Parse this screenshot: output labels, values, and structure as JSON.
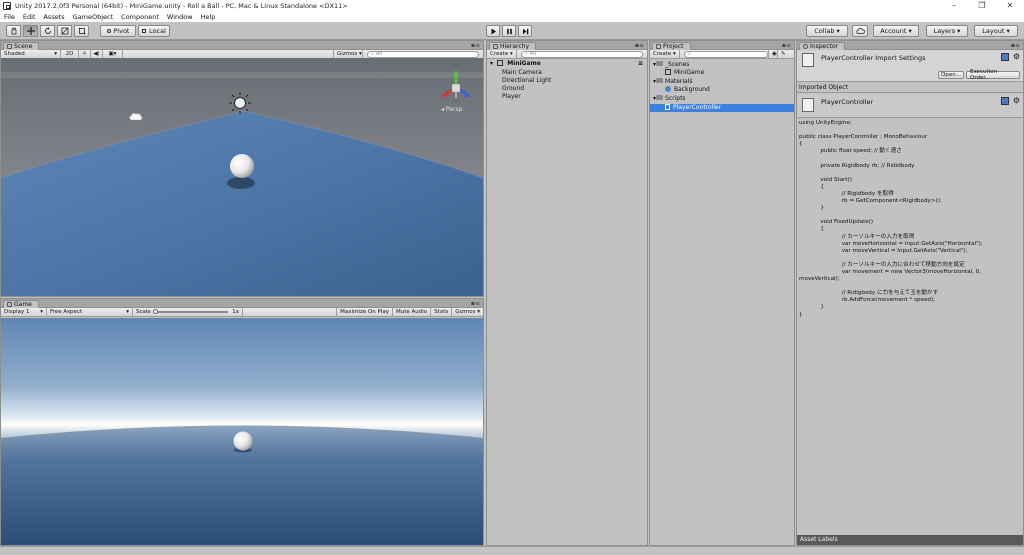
{
  "window": {
    "title": "Unity 2017.2.0f3 Personal (64bit) - MiniGame.unity - Roll a Ball - PC, Mac & Linux Standalone <DX11>",
    "minimize": "–",
    "maximize": "❐",
    "close": "✕"
  },
  "menu": [
    "File",
    "Edit",
    "Assets",
    "GameObject",
    "Component",
    "Window",
    "Help"
  ],
  "toolbar": {
    "pivot": "Pivot",
    "local": "Local",
    "collab": "Collab ▾",
    "account": "Account ▾",
    "layers": "Layers ▾",
    "layout": "Layout ▾"
  },
  "scene": {
    "tab": "Scene",
    "shading": "Shaded",
    "mode_2d": "2D",
    "gizmos": "Gizmos ▾",
    "search": "All",
    "persp": "Persp"
  },
  "game": {
    "tab": "Game",
    "display": "Display 1",
    "aspect": "Free Aspect",
    "scale_label": "Scale",
    "scale_value": "1x",
    "maximize": "Maximize On Play",
    "mute": "Mute Audio",
    "stats": "Stats",
    "gizmos": "Gizmos ▾"
  },
  "hierarchy": {
    "tab": "Hierarchy",
    "create": "Create ▾",
    "search": "All",
    "scene_name": "MiniGame",
    "items": [
      "Main Camera",
      "Directional Light",
      "Ground",
      "Player"
    ]
  },
  "project": {
    "tab": "Project",
    "create": "Create ▾",
    "tree": [
      {
        "label": "_Scenes",
        "kind": "folder",
        "depth": 0
      },
      {
        "label": "MiniGame",
        "kind": "scene",
        "depth": 1
      },
      {
        "label": "Materials",
        "kind": "folder",
        "depth": 0
      },
      {
        "label": "Background",
        "kind": "material",
        "depth": 1
      },
      {
        "label": "Scripts",
        "kind": "folder",
        "depth": 0
      },
      {
        "label": "PlayerController",
        "kind": "script",
        "depth": 1
      }
    ]
  },
  "inspector": {
    "tab": "Inspector",
    "import_title": "PlayerController Import Settings",
    "open_button": "Open...",
    "execution_order_button": "Execution Order...",
    "imported_object": "Imported Object",
    "object_name": "PlayerController",
    "asset_labels": "Asset Labels",
    "code": "using UnityEngine;\n\npublic class PlayerController : MonoBehaviour\n{\n\t\tpublic float speed; // 動く速さ\n\n\t\tprivate Rigidbody rb; // Rididbody\n\n\t\tvoid Start()\n\t\t{\n\t\t\t\t// Rigidbody を取得\n\t\t\t\trb = GetComponent<Rigidbody>();\n\t\t}\n\n\t\tvoid FixedUpdate()\n\t\t{\n\t\t\t\t// カーソルキーの入力を取得\n\t\t\t\tvar moveHorizontal = Input.GetAxis(\"Horizontal\");\n\t\t\t\tvar moveVertical = Input.GetAxis(\"Vertical\");\n\n\t\t\t\t// カーソルキーの入力に合わせて移動方向を設定\n\t\t\t\tvar movement = new Vector3(moveHorizontal, 0,\nmoveVertical);\n\n\t\t\t\t// Ridigbody に力を与えて玉を動かす\n\t\t\t\trb.AddForce(movement * speed);\n\t\t}\n}"
  },
  "colors": {
    "editor_bg": "#c2c2c2",
    "selection": "#3d80df",
    "sky_top": "#6f7a88",
    "ground": "#4a6f9c"
  }
}
